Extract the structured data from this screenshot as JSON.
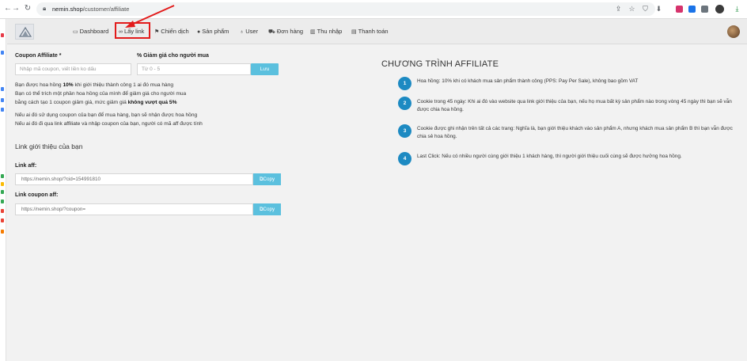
{
  "browser": {
    "url_host": "nemin.shop",
    "url_path": "/customer/affiliate"
  },
  "header": {
    "nav": [
      {
        "label": "Dashboard",
        "icon": "monitor-icon"
      },
      {
        "label": "Lấy link",
        "icon": "link-icon"
      },
      {
        "label": "Chiến dịch",
        "icon": "flag-icon"
      },
      {
        "label": "Sản phẩm",
        "icon": "tag-icon"
      },
      {
        "label": "User",
        "icon": "user-icon"
      },
      {
        "label": "Đơn hàng",
        "icon": "truck-icon"
      },
      {
        "label": "Thu nhập",
        "icon": "chart-icon"
      },
      {
        "label": "Thanh toán",
        "icon": "card-icon"
      }
    ],
    "highlight_color": "#e21b1b"
  },
  "form": {
    "coupon_label": "Coupon Affiliate *",
    "coupon_placeholder": "Nhập mã coupon, viết liền ko dấu",
    "discount_label": "% Giảm giá cho người mua",
    "discount_placeholder": "Từ 0 - 5",
    "save_label": "Lưu"
  },
  "info": {
    "line1_pre": "Bạn được hoa hồng ",
    "line1_bold": "10%",
    "line1_post": " khi giới thiệu thành công 1 ai đó mua hàng",
    "line2": "Bạn có thể trích một phần hoa hồng của mình để giảm giá cho người mua",
    "line3_pre": "bằng cách tạo 1 coupon giảm giá, mức giảm giá ",
    "line3_bold": "không vượt quá 5%",
    "line4": "Nếu ai đó sử dụng coupon của bạn để mua hàng, bạn sẽ nhận được hoa hồng",
    "line5": "Nếu ai đó đi qua link affiliate và nhập coupon của bạn, người có mã aff được tính"
  },
  "links": {
    "section_title": "Link giới thiệu của bạn",
    "aff_label": "Link aff:",
    "aff_value": "https://nemin.shop/?cid=154991810",
    "coupon_label": "Link coupon aff:",
    "coupon_value": "https://nemin.shop/?coupon=",
    "copy_label": "Copy"
  },
  "program": {
    "title": "CHƯƠNG TRÌNH AFFILIATE",
    "accent": "#1d8ac2",
    "steps": [
      {
        "num": "1",
        "text": "Hoa hồng: 10% khi có khách mua sản phẩm thành công (PPS: Pay Per Sale), không bao gồm VAT"
      },
      {
        "num": "2",
        "text": "Cookie trong 45 ngày: Khi ai đó vào website qua link giới thiệu của bạn, nếu họ mua bất kỳ sản phẩm nào trong vòng 45 ngày thì bạn sẽ vẫn được chia hoa hồng."
      },
      {
        "num": "3",
        "text": "Cookie được ghi nhận trên tất cả các trang: Nghĩa là, bạn giới thiệu khách vào sản phẩm A, nhưng khách mua sản phẩm B thì bạn vẫn được chia sẻ hoa hồng."
      },
      {
        "num": "4",
        "text": "Last Click: Nếu có nhiều người cùng giới thiệu 1 khách hàng, thì người giới thiệu cuối cùng sẽ được hưởng hoa hồng."
      }
    ]
  }
}
